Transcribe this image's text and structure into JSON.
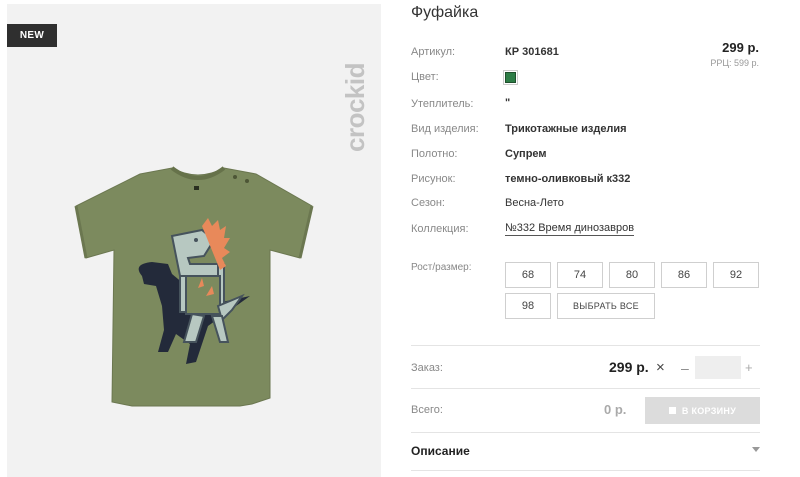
{
  "image": {
    "badge": "NEW",
    "brand_logo": "crockid"
  },
  "product": {
    "title": "Фуфайка",
    "price": "299 р.",
    "rrp": "РРЦ: 599 р."
  },
  "specs": {
    "sku": {
      "label": "Артикул:",
      "value": "КР 301681"
    },
    "color": {
      "label": "Цвет:",
      "swatch": "#2d7d46"
    },
    "insulation": {
      "label": "Утеплитель:",
      "value": "\""
    },
    "type": {
      "label": "Вид изделия:",
      "value": "Трикотажные изделия"
    },
    "fabric": {
      "label": "Полотно:",
      "value": "Супрем"
    },
    "pattern": {
      "label": "Рисунок:",
      "value": "темно-оливковый к332"
    },
    "season": {
      "label": "Сезон:",
      "value": "Весна-Лето"
    },
    "collection": {
      "label": "Коллекция:",
      "value": "№332 Время динозавров"
    }
  },
  "sizes": {
    "label": "Рост/размер:",
    "options": [
      "68",
      "74",
      "80",
      "86",
      "92",
      "98"
    ],
    "select_all": "ВЫБРАТЬ ВСЕ"
  },
  "order": {
    "label": "Заказ:",
    "price": "299 р.",
    "quantity": "",
    "minus": "–",
    "plus": "+",
    "times": "×"
  },
  "total": {
    "label": "Всего:",
    "value": "0 р.",
    "cart_button": "В КОРЗИНУ"
  },
  "description": {
    "title": "Описание"
  },
  "colors": {
    "shirt": "#7c8a5e",
    "badge_bg": "#2f2f2f",
    "cart_disabled": "#dcdcdc"
  }
}
